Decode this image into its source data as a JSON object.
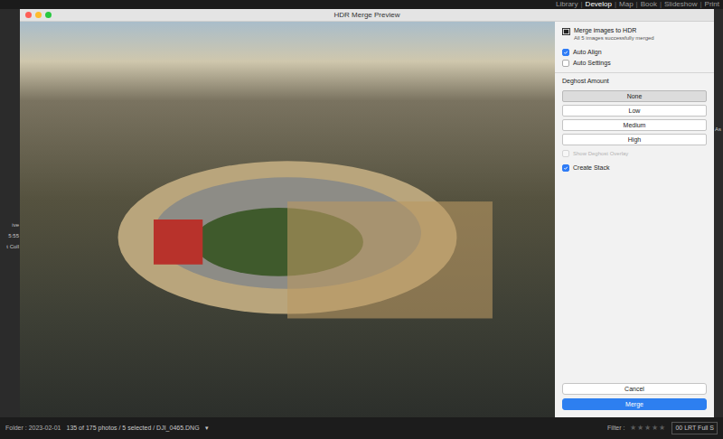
{
  "top_bar": {
    "modules": [
      {
        "label": "Library",
        "selected": false
      },
      {
        "label": "Develop",
        "selected": true
      },
      {
        "label": "Map",
        "selected": false
      },
      {
        "label": "Book",
        "selected": false
      },
      {
        "label": "Slideshow",
        "selected": false
      },
      {
        "label": "Print",
        "selected": false
      }
    ],
    "separator": "|"
  },
  "left_edge": [
    "ive",
    "5:55",
    "t Coll"
  ],
  "right_edge": [
    "As"
  ],
  "window": {
    "title": "HDR Merge Preview"
  },
  "panel": {
    "heading": "Merge images to HDR",
    "subheading": "All 5 images successfully merged",
    "options": [
      {
        "label": "Auto Align",
        "checked": true
      },
      {
        "label": "Auto Settings",
        "checked": false
      }
    ],
    "deghost": {
      "label": "Deghost Amount",
      "choices": [
        {
          "label": "None",
          "selected": true
        },
        {
          "label": "Low",
          "selected": false
        },
        {
          "label": "Medium",
          "selected": false
        },
        {
          "label": "High",
          "selected": false
        }
      ]
    },
    "overlay": {
      "label": "Show Deghost Overlay",
      "checked": false,
      "disabled": true
    },
    "create_stack": {
      "label": "Create Stack",
      "checked": true
    }
  },
  "buttons": [
    {
      "label": "Cancel",
      "primary": false
    },
    {
      "label": "Merge",
      "primary": true
    }
  ],
  "status_bar": {
    "folder": "Folder : 2023-02-01",
    "count": "135 of 175 photos / 5 selected / DJI_0465.DNG",
    "dropdown": "▾",
    "filter": "Filter :",
    "stars": "★★★★★",
    "preset": "00 LRT Full S"
  }
}
